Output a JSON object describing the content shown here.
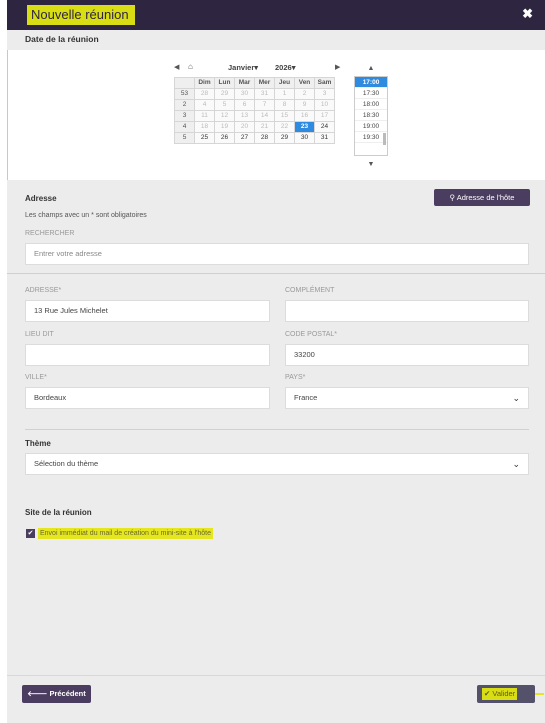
{
  "modal": {
    "title": "Nouvelle réunion",
    "close_symbol": "✖"
  },
  "date_section": {
    "label": "Date de la réunion"
  },
  "calendar": {
    "prev_symbol": "◀",
    "home_symbol": "⌂",
    "month": "Janvier",
    "year": "2026",
    "next_symbol": "▶",
    "weekday_headers": [
      "Dim",
      "Lun",
      "Mar",
      "Mer",
      "Jeu",
      "Ven",
      "Sam"
    ],
    "weeks": [
      {
        "week": "53",
        "days": [
          "28",
          "29",
          "30",
          "31",
          "1",
          "2",
          "3"
        ]
      },
      {
        "week": "2",
        "days": [
          "4",
          "5",
          "6",
          "7",
          "8",
          "9",
          "10"
        ]
      },
      {
        "week": "3",
        "days": [
          "11",
          "12",
          "13",
          "14",
          "15",
          "16",
          "17"
        ]
      },
      {
        "week": "4",
        "days": [
          "18",
          "19",
          "20",
          "21",
          "22",
          "23",
          "24"
        ]
      },
      {
        "week": "5",
        "days": [
          "25",
          "26",
          "27",
          "28",
          "29",
          "30",
          "31"
        ]
      }
    ],
    "selected_day": "23",
    "times": [
      "17:00",
      "17:30",
      "18:00",
      "18:30",
      "19:00",
      "19:30"
    ],
    "selected_time": "17:00",
    "time_up": "▲",
    "time_down": "▼"
  },
  "address": {
    "heading": "Adresse",
    "host_button": "Adresse de l'hôte",
    "required_note": "Les champs avec un * sont obligatoires",
    "search_label": "RECHERCHER",
    "search_placeholder": "Entrer votre adresse",
    "adresse_label": "ADRESSE*",
    "adresse_value": "13 Rue Jules Michelet",
    "complement_label": "COMPLÉMENT",
    "complement_value": "",
    "lieu_label": "LIEU DIT",
    "lieu_value": "",
    "cp_label": "CODE POSTAL*",
    "cp_value": "33200",
    "ville_label": "VILLE*",
    "ville_value": "Bordeaux",
    "pays_label": "PAYS*",
    "pays_value": "France"
  },
  "theme": {
    "heading": "Thème",
    "value": "Sélection du thème"
  },
  "site": {
    "heading": "Site de la réunion",
    "checkbox_checked": true,
    "checkbox_label": "Envoi immédiat du mail de création du mini-site à l'hôte"
  },
  "footer": {
    "prev_label": "Précédent",
    "valider_label": "Valider"
  },
  "colors": {
    "titlebar": "#2e2640",
    "highlight": "#d9dd14",
    "button": "#4b3d5f",
    "selected": "#2e8bdf"
  }
}
